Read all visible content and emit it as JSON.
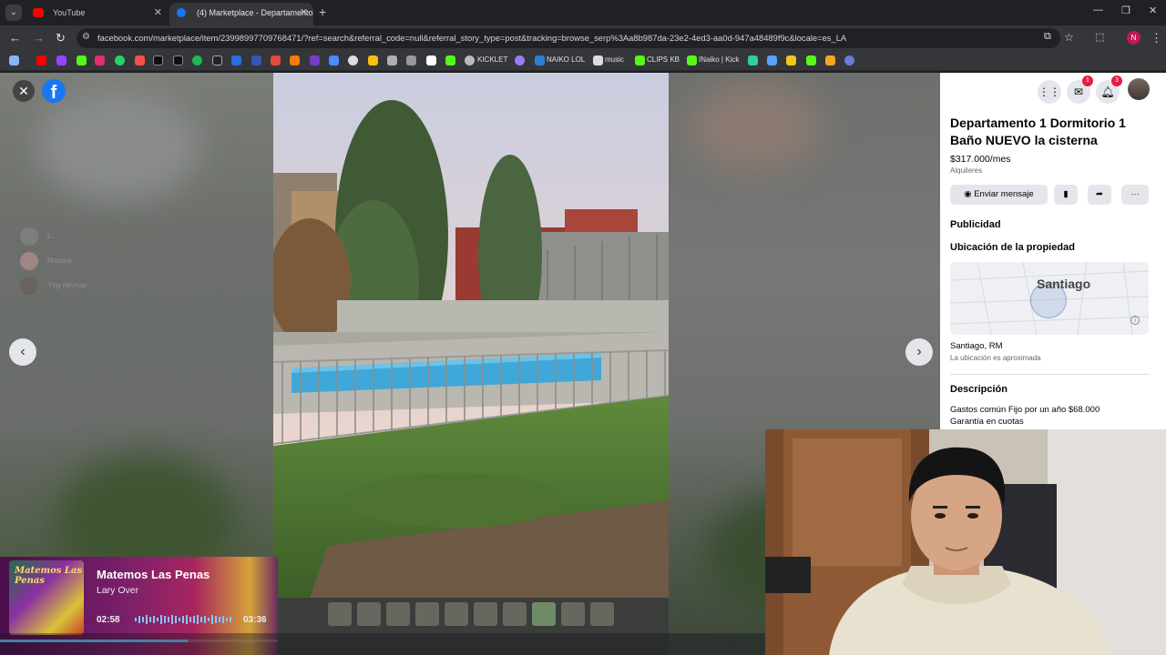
{
  "browser": {
    "tabs": [
      {
        "label": "YouTube",
        "active": false,
        "favicon_color": "#ff0000"
      },
      {
        "label": "(4) Marketplace - Departamento",
        "active": true,
        "favicon_color": "#1877f2"
      }
    ],
    "url": "facebook.com/marketplace/item/23998997709768471/?ref=search&referral_code=null&referral_story_type=post&tracking=browse_serp%3Aa8b987da-23e2-4ed3-aa0d-947a48489f9c&locale=es_LA",
    "profile_initial": "N",
    "bookmarks": [
      "KICKLET",
      "NAIKO LOL",
      "music",
      "CLIPS KB",
      "INaiko | Kick"
    ]
  },
  "viewer": {
    "chat_names": [
      "L.",
      "Masare",
      "Yng neymar"
    ]
  },
  "listing": {
    "title": "Departamento 1 Dormitorio 1 Baño NUEVO la cisterna",
    "price": "$317.000/mes",
    "category": "Alquileres",
    "send_message_label": "Enviar mensaje",
    "sponsored_label": "Publicidad",
    "location_heading": "Ubicación de la propiedad",
    "map_label": "Santiago",
    "location": "Santiago, RM",
    "location_note": "La ubicación es aproximada",
    "description_heading": "Descripción",
    "description_lines": [
      "Gastos común Fijo por un año $68.000",
      "Garantía en cuotas"
    ],
    "badges": {
      "messenger": "1",
      "notifications": "3"
    }
  },
  "music": {
    "title": "Matemos Las Penas",
    "artist": "Lary Over",
    "current_time": "02:58",
    "total_time": "03:36",
    "progress": 0.824,
    "album_text": "Matemos Las Penas"
  },
  "colors": {
    "facebook_blue": "#1877f2",
    "badge_red": "#e41e3f",
    "progress_accent": "#6ec3ff"
  }
}
